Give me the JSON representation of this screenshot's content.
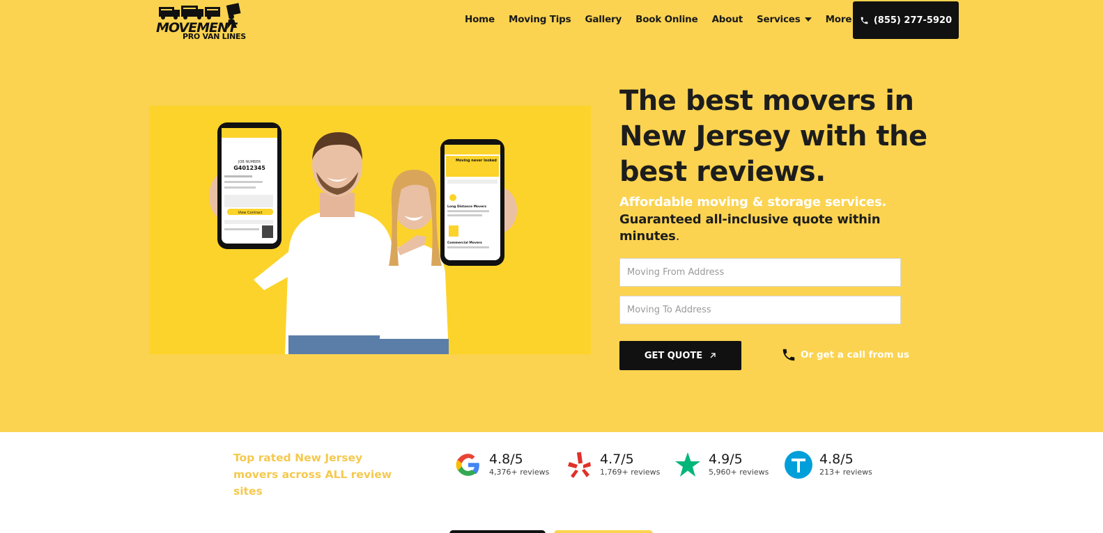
{
  "header": {
    "logo_text": "MOVEMENT",
    "logo_subtext": "PRO VAN LINES",
    "nav": [
      {
        "label": "Home"
      },
      {
        "label": "Moving Tips"
      },
      {
        "label": "Gallery"
      },
      {
        "label": "Book Online"
      },
      {
        "label": "About"
      },
      {
        "label": "Services",
        "dropdown": true
      },
      {
        "label": "More",
        "dropdown": true
      }
    ],
    "phone_label": "(855) 277-5920"
  },
  "hero": {
    "headline": "The best movers in New Jersey with the best reviews.",
    "subheadline_white": "Affordable moving & storage services.",
    "subheadline_dark": "Guaranteed all-inclusive quote within minutes",
    "subheadline_period": ".",
    "from_placeholder": "Moving From Address",
    "to_placeholder": "Moving To Address",
    "quote_button": "GET QUOTE",
    "call_link": "Or get a call from us",
    "phone_screen_left": {
      "job_label": "JOB NUMBER",
      "job_number": "G4012345",
      "button": "View Contract"
    },
    "phone_screen_right": {
      "banner": "Moving never looked",
      "item1": "Long Distance Movers",
      "item2": "Commercial Movers"
    }
  },
  "reviews": {
    "tagline": "Top rated New Jersey movers across ALL review sites",
    "sites": [
      {
        "icon": "google-icon",
        "score": "4.8/5",
        "count": "4,376+ reviews"
      },
      {
        "icon": "yelp-icon",
        "score": "4.7/5",
        "count": "1,769+ reviews"
      },
      {
        "icon": "trustpilot-icon",
        "score": "4.9/5",
        "count": "5,960+ reviews"
      },
      {
        "icon": "thumbtack-icon",
        "score": "4.8/5",
        "count": "213+ reviews"
      }
    ]
  },
  "colors": {
    "brand_yellow": "#fbd350",
    "dark": "#111111",
    "google_blue": "#4285f4",
    "yelp_red": "#e0312a",
    "trustpilot_green": "#00b67a",
    "thumbtack_blue": "#009fd9"
  }
}
